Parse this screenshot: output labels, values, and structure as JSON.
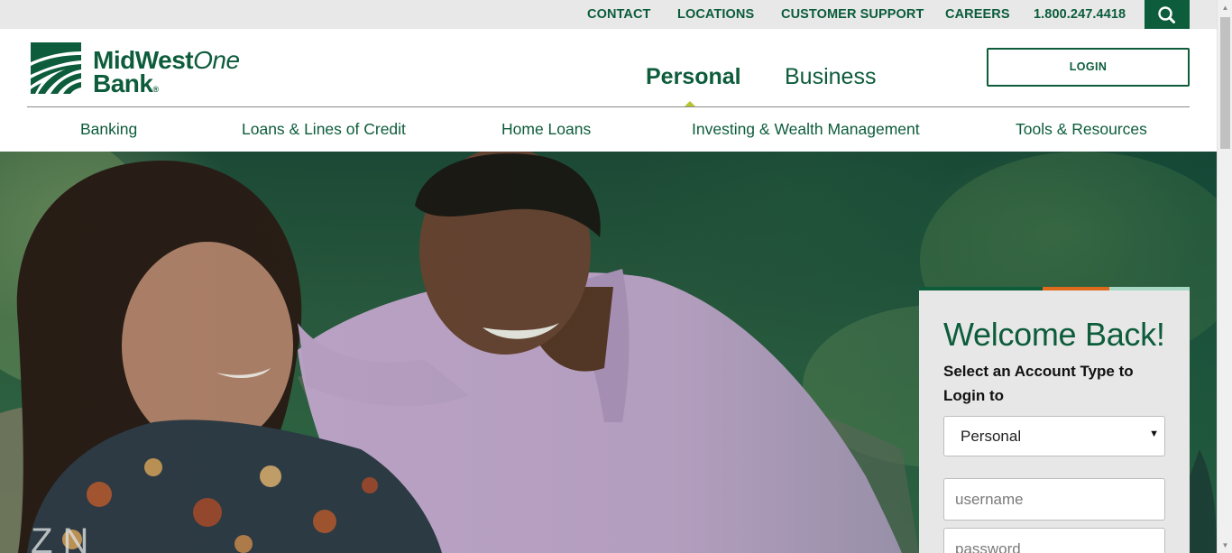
{
  "utility_nav": {
    "items": [
      {
        "label": "CONTACT"
      },
      {
        "label": "LOCATIONS"
      },
      {
        "label": "CUSTOMER SUPPORT"
      },
      {
        "label": "CAREERS"
      },
      {
        "label": "1.800.247.4418"
      }
    ],
    "search_icon": "search-icon"
  },
  "brand": {
    "name_part1": "MidWest",
    "name_part2": "One",
    "name_line2": "Bank",
    "registered": "®",
    "colors": {
      "primary": "#0d5c3b",
      "accent": "#b7c42e",
      "orange": "#e06a1b"
    }
  },
  "segments": {
    "personal": "Personal",
    "business": "Business",
    "active": "Personal"
  },
  "login_button": {
    "label": "LOGIN"
  },
  "main_nav": {
    "items": [
      {
        "label": "Banking"
      },
      {
        "label": "Loans & Lines of Credit"
      },
      {
        "label": "Home Loans"
      },
      {
        "label": "Investing & Wealth Management"
      },
      {
        "label": "Tools & Resources"
      }
    ]
  },
  "login_panel": {
    "title": "Welcome Back!",
    "account_type_label": "Select an Account Type to Login to",
    "account_type_selected": "Personal",
    "username_placeholder": "username",
    "password_placeholder": "password"
  }
}
